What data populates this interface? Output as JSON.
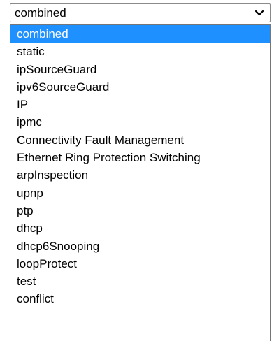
{
  "select": {
    "value": "combined",
    "icon": "chevron-down-icon"
  },
  "options": [
    "combined",
    "static",
    "ipSourceGuard",
    "ipv6SourceGuard",
    "IP",
    "ipmc",
    "Connectivity Fault Management",
    "Ethernet Ring Protection Switching",
    "arpInspection",
    "upnp",
    "ptp",
    "dhcp",
    "dhcp6Snooping",
    "loopProtect",
    "test",
    "conflict"
  ],
  "selected_index": 0,
  "colors": {
    "highlight": "#1e90ff",
    "highlight_text": "#ffffff",
    "border": "#767676"
  }
}
